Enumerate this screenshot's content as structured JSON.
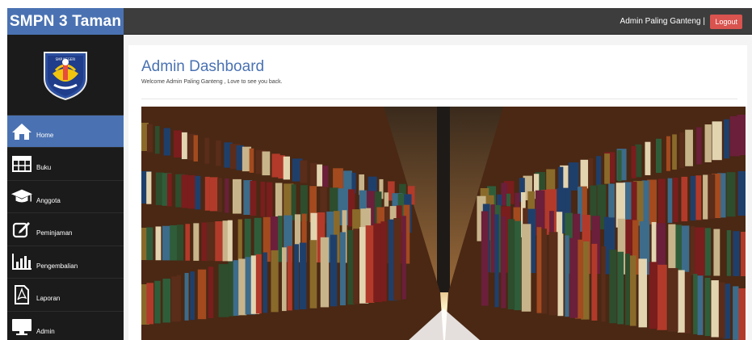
{
  "brand": {
    "title": "SMPN 3 Taman",
    "logo_text": "SMP NEGERI"
  },
  "topbar": {
    "admin_name": "Admin Paling Ganteng |",
    "logout_label": "Logout"
  },
  "sidebar": {
    "items": [
      {
        "label": "Home",
        "icon": "home-icon",
        "active": true
      },
      {
        "label": "Buku",
        "icon": "table-icon"
      },
      {
        "label": "Anggota",
        "icon": "graduation-cap-icon"
      },
      {
        "label": "Peminjaman",
        "icon": "edit-icon"
      },
      {
        "label": "Pengembalian",
        "icon": "bar-chart-icon"
      },
      {
        "label": "Laporan",
        "icon": "pdf-icon"
      },
      {
        "label": "Admin",
        "icon": "monitor-icon"
      }
    ]
  },
  "main": {
    "title": "Admin Dashboard",
    "welcome": "Welcome Admin Paling Ganteng , Love to see you back."
  },
  "colors": {
    "accent": "#4a72b2",
    "sidebar": "#1b1b1b",
    "topbar": "#3d3d3d",
    "logout": "#d9534f"
  }
}
